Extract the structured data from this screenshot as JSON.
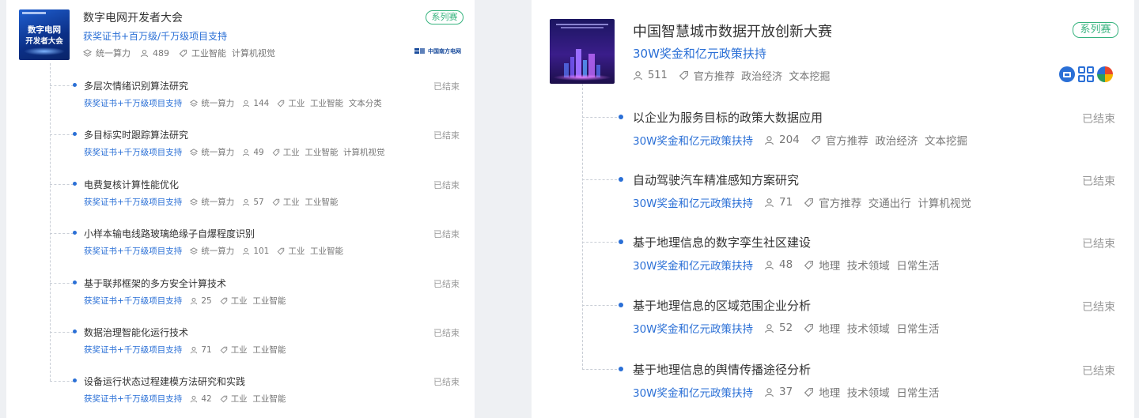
{
  "colors": {
    "accent": "#2a6fd6",
    "badge_green": "#36b37e",
    "muted": "#777777",
    "status_gray": "#999999"
  },
  "left": {
    "thumb_text": [
      "数字电网",
      "开发者大会"
    ],
    "title": "数字电网开发者大会",
    "badge": "系列赛",
    "promo": "获奖证书+百万级/千万级项目支持",
    "meta": {
      "compute": "统一算力",
      "participants": "489",
      "tags": "工业智能  计算机视觉"
    },
    "sponsor_logo_text": "中国南方电网",
    "items": [
      {
        "title": "多层次情绪识别算法研究",
        "status": "已结束",
        "promo": "获奖证书+千万级项目支持",
        "compute": "统一算力",
        "participants": "144",
        "tags": "工业  工业智能  文本分类"
      },
      {
        "title": "多目标实时跟踪算法研究",
        "status": "已结束",
        "promo": "获奖证书+千万级项目支持",
        "compute": "统一算力",
        "participants": "49",
        "tags": "工业  工业智能  计算机视觉"
      },
      {
        "title": "电费复核计算性能优化",
        "status": "已结束",
        "promo": "获奖证书+千万级项目支持",
        "compute": "统一算力",
        "participants": "57",
        "tags": "工业  工业智能"
      },
      {
        "title": "小样本输电线路玻璃绝缘子自爆程度识别",
        "status": "已结束",
        "promo": "获奖证书+千万级项目支持",
        "compute": "统一算力",
        "participants": "101",
        "tags": "工业  工业智能"
      },
      {
        "title": "基于联邦框架的多方安全计算技术",
        "status": "已结束",
        "promo": "获奖证书+千万级项目支持",
        "compute": "",
        "participants": "25",
        "tags": "工业  工业智能"
      },
      {
        "title": "数据治理智能化运行技术",
        "status": "已结束",
        "promo": "获奖证书+千万级项目支持",
        "compute": "",
        "participants": "71",
        "tags": "工业  工业智能"
      },
      {
        "title": "设备运行状态过程建模方法研究和实践",
        "status": "已结束",
        "promo": "获奖证书+千万级项目支持",
        "compute": "",
        "participants": "42",
        "tags": "工业  工业智能"
      }
    ]
  },
  "right": {
    "title": "中国智慧城市数据开放创新大赛",
    "badge": "系列赛",
    "promo": "30W奖金和亿元政策扶持",
    "meta": {
      "participants": "511",
      "tags": "官方推荐  政治经济  文本挖掘"
    },
    "items": [
      {
        "title": "以企业为服务目标的政策大数据应用",
        "status": "已结束",
        "promo": "30W奖金和亿元政策扶持",
        "participants": "204",
        "tags": "官方推荐  政治经济  文本挖掘"
      },
      {
        "title": "自动驾驶汽车精准感知方案研究",
        "status": "已结束",
        "promo": "30W奖金和亿元政策扶持",
        "participants": "71",
        "tags": "官方推荐  交通出行  计算机视觉"
      },
      {
        "title": "基于地理信息的数字孪生社区建设",
        "status": "已结束",
        "promo": "30W奖金和亿元政策扶持",
        "participants": "48",
        "tags": "地理  技术领域  日常生活"
      },
      {
        "title": "基于地理信息的区域范围企业分析",
        "status": "已结束",
        "promo": "30W奖金和亿元政策扶持",
        "participants": "52",
        "tags": "地理  技术领域  日常生活"
      },
      {
        "title": "基于地理信息的舆情传播途径分析",
        "status": "已结束",
        "promo": "30W奖金和亿元政策扶持",
        "participants": "37",
        "tags": "地理  技术领域  日常生活"
      }
    ]
  }
}
